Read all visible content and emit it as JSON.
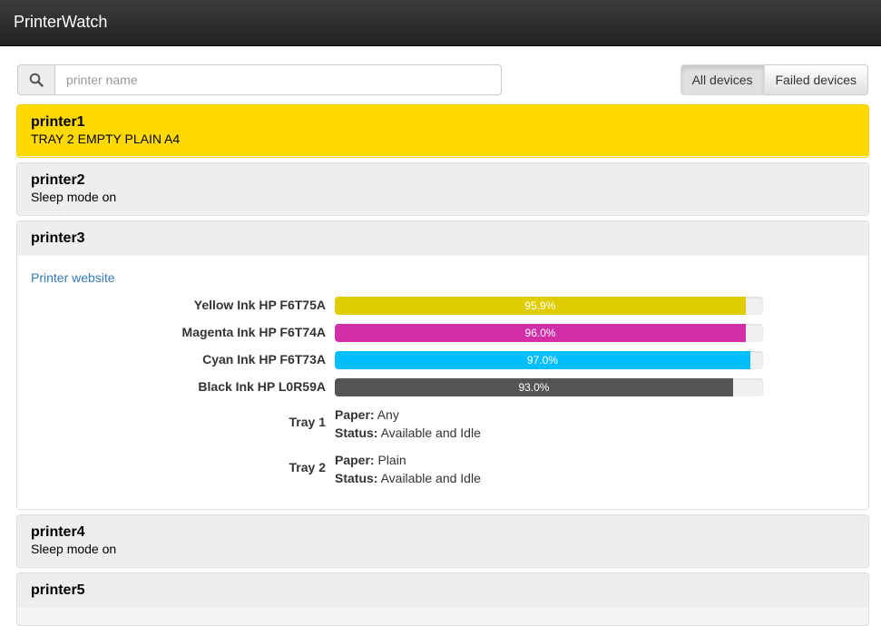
{
  "app": {
    "title": "PrinterWatch"
  },
  "search": {
    "placeholder": "printer name",
    "value": ""
  },
  "filters": {
    "all": "All devices",
    "failed": "Failed devices",
    "active": "all"
  },
  "printers": [
    {
      "name": "printer1",
      "status": "TRAY 2 EMPTY PLAIN A4",
      "state": "warning"
    },
    {
      "name": "printer2",
      "status": "Sleep mode on",
      "state": "normal"
    },
    {
      "name": "printer3",
      "state": "expanded",
      "link": "Printer website",
      "inks": [
        {
          "label": "Yellow Ink HP F6T75A",
          "percent": 95.9,
          "text": "95.9%",
          "color": "#dfcd00"
        },
        {
          "label": "Magenta Ink HP F6T74A",
          "percent": 96.0,
          "text": "96.0%",
          "color": "#d22ea8"
        },
        {
          "label": "Cyan Ink HP F6T73A",
          "percent": 97.0,
          "text": "97.0%",
          "color": "#00bfff"
        },
        {
          "label": "Black Ink HP L0R59A",
          "percent": 93.0,
          "text": "93.0%",
          "color": "#555555"
        }
      ],
      "trays": [
        {
          "label": "Tray 1",
          "paper_label": "Paper:",
          "paper": "Any",
          "status_label": "Status:",
          "status": "Available and Idle"
        },
        {
          "label": "Tray 2",
          "paper_label": "Paper:",
          "paper": "Plain",
          "status_label": "Status:",
          "status": "Available and Idle"
        }
      ]
    },
    {
      "name": "printer4",
      "status": "Sleep mode on",
      "state": "normal"
    },
    {
      "name": "printer5",
      "status": "",
      "state": "normal"
    }
  ],
  "icons": {
    "search": "search-icon"
  }
}
